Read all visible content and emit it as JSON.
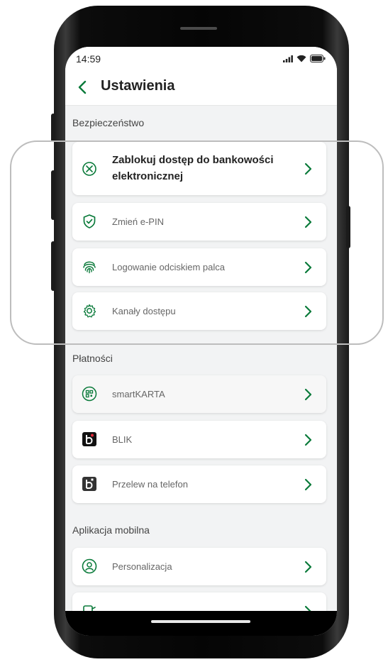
{
  "status_bar": {
    "time": "14:59"
  },
  "header": {
    "title": "Ustawienia"
  },
  "sections": {
    "security": {
      "label": "Bezpieczeństwo",
      "items": [
        {
          "label": "Zablokuj dostęp do bankowości elektronicznej",
          "icon": "block-circle-icon"
        },
        {
          "label": "Zmień e-PIN",
          "icon": "shield-check-icon"
        },
        {
          "label": "Logowanie odciskiem palca",
          "icon": "fingerprint-icon"
        },
        {
          "label": "Kanały dostępu",
          "icon": "gear-icon"
        }
      ]
    },
    "payments": {
      "label": "Płatności",
      "items": [
        {
          "label": "smartKARTA",
          "icon": "qr-circle-icon"
        },
        {
          "label": "BLIK",
          "icon": "blik-icon"
        },
        {
          "label": "Przelew na telefon",
          "icon": "blik-phone-icon"
        }
      ]
    },
    "mobile_app": {
      "label": "Aplikacja mobilna",
      "items": [
        {
          "label": "Personalizacja",
          "icon": "user-circle-icon"
        }
      ]
    }
  },
  "colors": {
    "accent": "#0a7a3a",
    "chevron": "#0a7a3a",
    "background": "#f2f3f4",
    "card": "#ffffff"
  }
}
